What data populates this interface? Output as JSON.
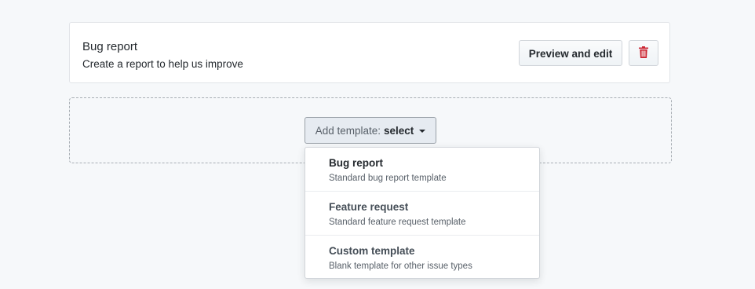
{
  "template_card": {
    "title": "Bug report",
    "description": "Create a report to help us improve",
    "preview_button_label": "Preview and edit",
    "delete_icon": "trash-icon",
    "delete_icon_color": "#cb2431"
  },
  "add_template": {
    "label_prefix": "Add template:",
    "label_selected": "select",
    "caret_icon": "caret-down-icon"
  },
  "dropdown": {
    "items": [
      {
        "title": "Bug report",
        "description": "Standard bug report template"
      },
      {
        "title": "Feature request",
        "description": "Standard feature request template"
      },
      {
        "title": "Custom template",
        "description": "Blank template for other issue types"
      }
    ]
  }
}
